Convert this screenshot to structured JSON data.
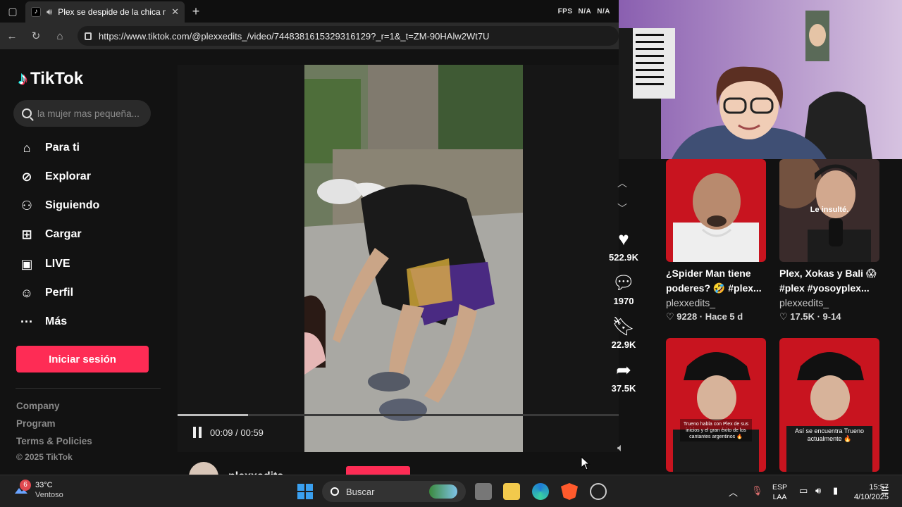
{
  "browser": {
    "tab_title": "Plex se despide de la chica m",
    "url": "https://www.tiktok.com/@plexxedits_/video/7448381615329316129?_r=1&_t=ZM-90HAlw2Wt7U",
    "overlay": [
      "FPS",
      "N/A",
      "N/A"
    ]
  },
  "sidebar": {
    "brand": "TikTok",
    "search_placeholder": "la mujer mas pequeña...",
    "nav": [
      {
        "label": "Para ti",
        "icon": "home-icon"
      },
      {
        "label": "Explorar",
        "icon": "compass-icon"
      },
      {
        "label": "Siguiendo",
        "icon": "following-icon"
      },
      {
        "label": "Cargar",
        "icon": "upload-icon"
      },
      {
        "label": "LIVE",
        "icon": "live-icon"
      },
      {
        "label": "Perfil",
        "icon": "profile-icon"
      },
      {
        "label": "Más",
        "icon": "more-icon"
      }
    ],
    "login_button": "Iniciar sesión",
    "footer": [
      "Company",
      "Program",
      "Terms & Policies"
    ],
    "copyright": "© 2025 TikTok"
  },
  "player": {
    "time": "00:09 / 00:59",
    "progress": 0.16,
    "author": "plexxedits_"
  },
  "actions": {
    "likes": "522.9K",
    "comments": "1970",
    "saves": "22.9K",
    "shares": "37.5K"
  },
  "related": [
    {
      "title": "¿Spider Man tiene poderes? 🤣 #plex...",
      "author": "plexxedits_",
      "stats": "♡ 9228 · Hace 5 d",
      "caption": ""
    },
    {
      "title": "Plex, Xokas y Bali 😱 #plex #yosoyplex...",
      "author": "plexxedits_",
      "stats": "♡ 17.5K · 9-14",
      "caption": "Le insulté."
    },
    {
      "title": "",
      "author": "",
      "stats": "",
      "caption": "Trueno habla con Plex de sus inicios y el gran éxito de los cantantes argentinos 🔥"
    },
    {
      "title": "",
      "author": "",
      "stats": "",
      "caption": "Así se encuentra Trueno actualmente 🔥"
    }
  ],
  "taskbar": {
    "weather_badge": "6",
    "temp": "33°C",
    "condition": "Ventoso",
    "search": "Buscar",
    "lang": [
      "ESP",
      "LAA"
    ],
    "time": "15:57",
    "date": "4/10/2025"
  },
  "colors": {
    "brand": "#fe2c55",
    "page_bg": "#121212"
  }
}
